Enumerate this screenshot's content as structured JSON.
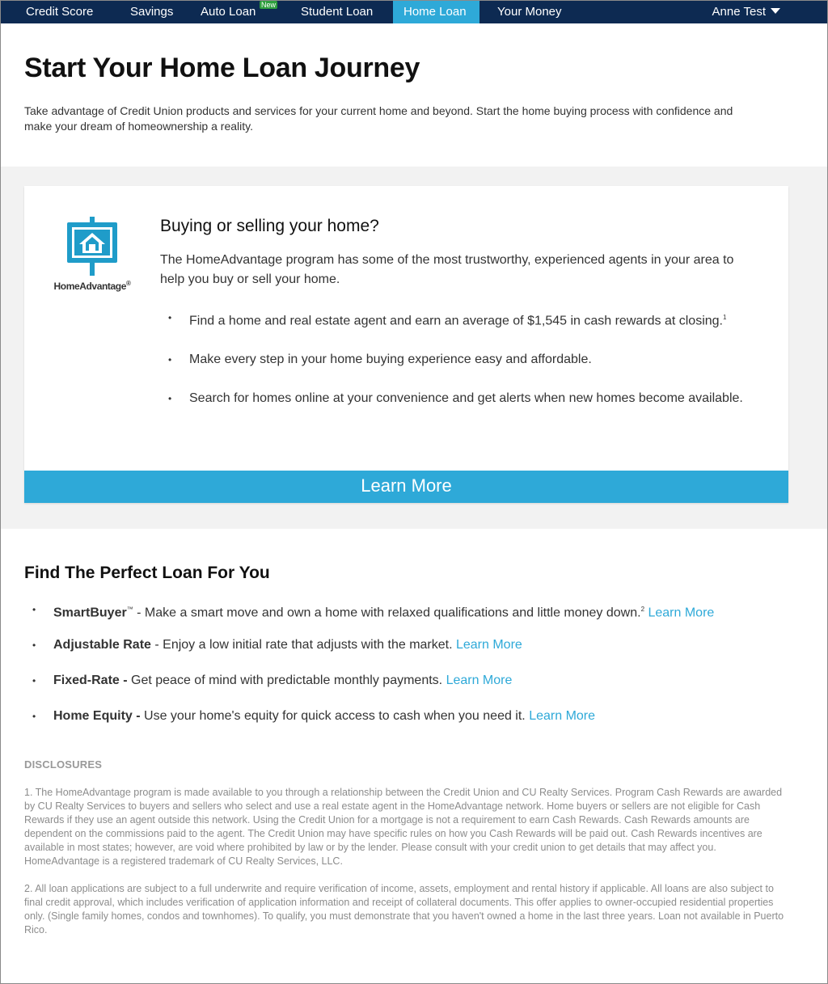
{
  "nav": {
    "items": [
      {
        "label": "Credit Score"
      },
      {
        "label": "Savings"
      },
      {
        "label": "Auto Loan"
      },
      {
        "label": "Student Loan"
      },
      {
        "label": "Home Loan"
      },
      {
        "label": "Your Money"
      }
    ],
    "new_badge": "New",
    "user": "Anne Test",
    "active": "Home Loan",
    "colors": {
      "bar": "#0d2a52",
      "active": "#2ea9d8",
      "badge": "#2e9e3e"
    }
  },
  "header": {
    "title": "Start Your Home Loan Journey",
    "intro": "Take advantage of Credit Union products and services for your current home and beyond. Start the home buying process with confidence and make your dream of homeownership a reality."
  },
  "card": {
    "logo_text": "HomeAdvantage",
    "logo_mark": "®",
    "title": "Buying or selling your home?",
    "description": "The HomeAdvantage program has some of the most trustworthy, experienced agents in your area to help you buy or sell your home.",
    "bullets": [
      {
        "text": "Find a home and real estate agent and earn an average of $1,545 in cash rewards at closing.",
        "sup": "1"
      },
      {
        "text": "Make every step in your home buying experience easy and affordable.",
        "sup": ""
      },
      {
        "text": "Search for homes online at your convenience and get alerts when new homes become available.",
        "sup": ""
      }
    ],
    "button": "Learn More"
  },
  "loans": {
    "title": "Find The Perfect Loan For You",
    "items": [
      {
        "name": "SmartBuyer",
        "tm": "™",
        "desc": " - Make a smart move and own a home with relaxed qualifications and little money down.",
        "sup": "2",
        "link": "Learn More"
      },
      {
        "name": "Adjustable Rate",
        "tm": "",
        "desc": " - Enjoy a low initial rate that adjusts with the market. ",
        "sup": "",
        "link": "Learn More"
      },
      {
        "name": "Fixed-Rate -",
        "tm": "",
        "desc": " Get peace of mind with predictable monthly payments. ",
        "sup": "",
        "link": "Learn More"
      },
      {
        "name": "Home Equity -",
        "tm": "",
        "desc": " Use your home's equity for quick access to cash when you need it. ",
        "sup": "",
        "link": "Learn More"
      }
    ]
  },
  "disclosures": {
    "title": "DISCLOSURES",
    "paragraphs": [
      "1. The HomeAdvantage program is made available to you through a relationship between the Credit Union and CU Realty Services. Program Cash Rewards are awarded by CU Realty Services to buyers and sellers who select and use a real estate agent in the HomeAdvantage network. Home buyers or sellers are not eligible for Cash Rewards if they use an agent outside this network. Using the Credit Union for a mortgage is not a requirement to earn Cash Rewards. Cash Rewards amounts are dependent on the commissions paid to the agent. The Credit Union may have specific rules on how you Cash Rewards will be paid out. Cash Rewards incentives are available in most states; however, are void where prohibited by law or by the lender. Please consult with your credit union to get details that may affect you. HomeAdvantage is a registered trademark of CU Realty Services, LLC.",
      "2. All loan applications are subject to a full underwrite and require verification of income, assets, employment and rental history if applicable. All loans are also subject to final credit approval, which includes verification of application information and receipt of collateral documents. This offer applies to owner-occupied residential properties only. (Single family homes, condos and townhomes). To qualify, you must demonstrate that you haven't owned a home in the last three years. Loan not available in Puerto Rico."
    ]
  }
}
